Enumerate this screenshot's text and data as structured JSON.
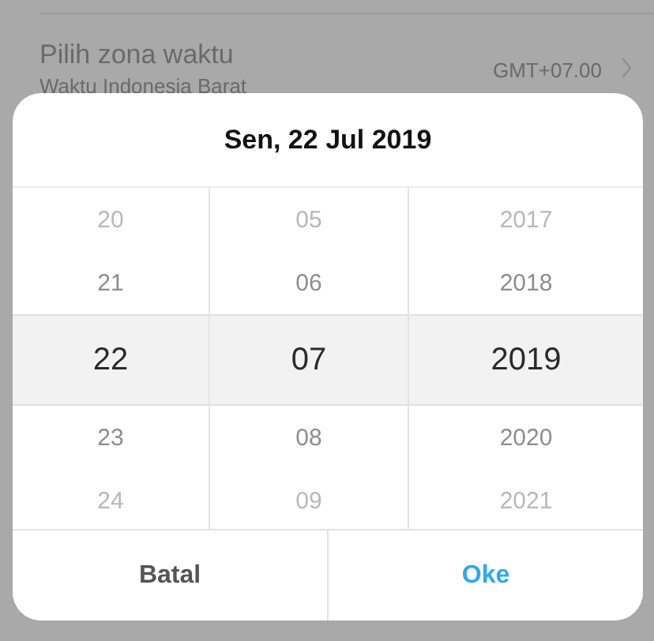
{
  "settings_row": {
    "title": "Pilih zona waktu",
    "subtitle": "Waktu Indonesia Barat",
    "value": "GMT+07.00"
  },
  "dialog": {
    "title": "Sen, 22 Jul 2019",
    "columns": [
      {
        "items": [
          {
            "label": "20",
            "selected": false
          },
          {
            "label": "21",
            "selected": false
          },
          {
            "label": "22",
            "selected": true
          },
          {
            "label": "23",
            "selected": false
          },
          {
            "label": "24",
            "selected": false
          }
        ]
      },
      {
        "items": [
          {
            "label": "05",
            "selected": false
          },
          {
            "label": "06",
            "selected": false
          },
          {
            "label": "07",
            "selected": true
          },
          {
            "label": "08",
            "selected": false
          },
          {
            "label": "09",
            "selected": false
          }
        ]
      },
      {
        "items": [
          {
            "label": "2017",
            "selected": false
          },
          {
            "label": "2018",
            "selected": false
          },
          {
            "label": "2019",
            "selected": true
          },
          {
            "label": "2020",
            "selected": false
          },
          {
            "label": "2021",
            "selected": false
          }
        ]
      }
    ],
    "buttons": [
      {
        "label": "Batal",
        "kind": "cancel"
      },
      {
        "label": "Oke",
        "kind": "confirm"
      }
    ]
  }
}
